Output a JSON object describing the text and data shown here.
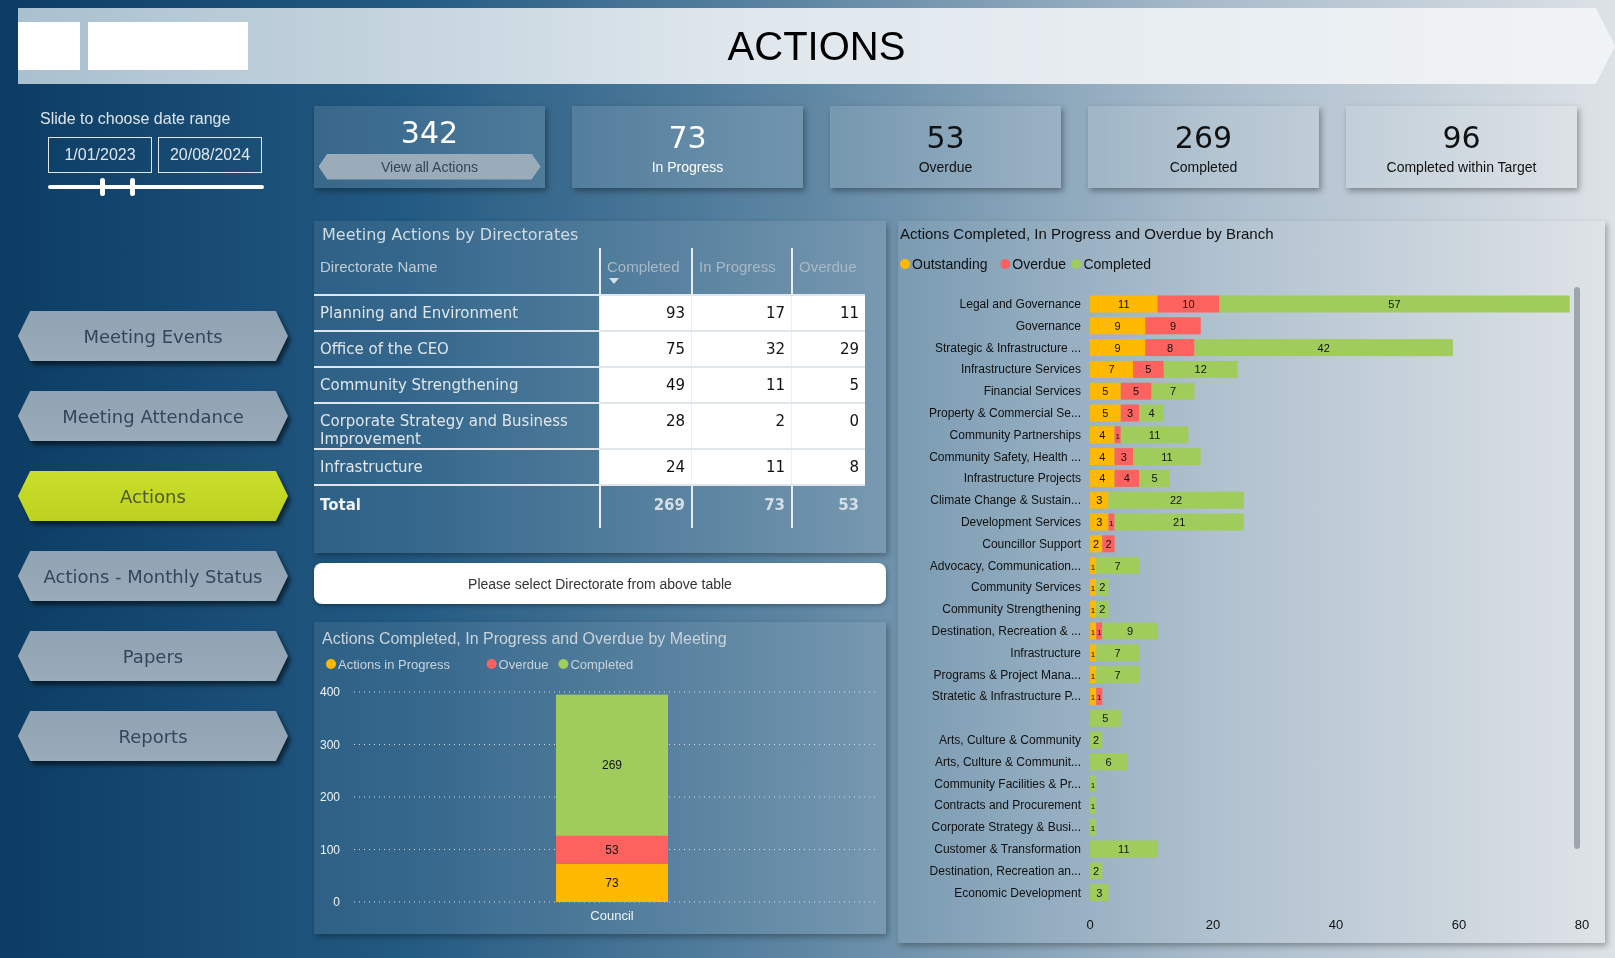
{
  "header": {
    "title": "ACTIONS"
  },
  "date_filter": {
    "label": "Slide to choose date range",
    "start": "1/01/2023",
    "end": "20/08/2024",
    "thumbs": [
      {
        "level": 0.25
      },
      {
        "level": 0.39
      }
    ]
  },
  "nav": [
    {
      "label": "Meeting Events",
      "selected": false
    },
    {
      "label": "Meeting Attendance",
      "selected": false
    },
    {
      "label": "Actions",
      "selected": true
    },
    {
      "label": "Actions - Monthly Status",
      "selected": false
    },
    {
      "label": "Papers",
      "selected": false
    },
    {
      "label": "Reports",
      "selected": false
    }
  ],
  "kpis": [
    {
      "value": "342",
      "button": "View all Actions"
    },
    {
      "value": "73",
      "label": "In Progress"
    },
    {
      "value": "53",
      "label": "Overdue"
    },
    {
      "value": "269",
      "label": "Completed"
    },
    {
      "value": "96",
      "label": "Completed within Target"
    }
  ],
  "directorate_table": {
    "title": "Meeting Actions by Directorates",
    "columns": [
      {
        "label": "Directorate Name",
        "sorted": false
      },
      {
        "label": "Completed",
        "sorted": true
      },
      {
        "label": "In Progress",
        "sorted": false
      },
      {
        "label": "Overdue",
        "sorted": false
      }
    ],
    "rows": [
      {
        "cells": [
          "Planning and Environment",
          "93",
          "17",
          "11"
        ]
      },
      {
        "cells": [
          "Office of the CEO",
          "75",
          "32",
          "29"
        ]
      },
      {
        "cells": [
          "Community Strengthening",
          "49",
          "11",
          "5"
        ]
      },
      {
        "cells": [
          "Corporate Strategy and Business Improvement",
          "28",
          "2",
          "0"
        ]
      },
      {
        "cells": [
          "Infrastructure",
          "24",
          "11",
          "8"
        ]
      }
    ],
    "total": [
      "Total",
      "269",
      "73",
      "53"
    ]
  },
  "message": "Please select Directorate from above table",
  "meeting_chart": {
    "chart_data": {
      "type": "bar",
      "title": "Actions Completed, In Progress and Overdue by Meeting",
      "categories": [
        "Council"
      ],
      "stacked": true,
      "orientation": "vertical",
      "data_labels": true,
      "grid": true,
      "legend": true,
      "ylim": [
        0,
        400
      ],
      "yticks": [
        0,
        100,
        200,
        300,
        400
      ],
      "series": [
        {
          "name": "Actions in Progress",
          "color": "#ffb900",
          "values": [
            73
          ]
        },
        {
          "name": "Overdue",
          "color": "#fd625e",
          "values": [
            53
          ]
        },
        {
          "name": "Completed",
          "color": "#a0cc5b",
          "values": [
            269
          ]
        }
      ]
    }
  },
  "branch_chart": {
    "chart_data": {
      "type": "bar",
      "title": "Actions Completed, In Progress and Overdue by Branch",
      "stacked": true,
      "orientation": "horizontal",
      "legend": true,
      "data_labels": true,
      "xlim": [
        0,
        80
      ],
      "xticks": [
        0,
        20,
        40,
        60,
        80
      ],
      "categories": [
        "Legal and Governance",
        "Governance",
        "Strategic & Infrastructure ...",
        "Infrastructure Services",
        "Financial Services",
        "Property & Commercial Se...",
        "Community Partnerships",
        "Community Safety, Health ...",
        "Infrastructure Projects",
        "Climate Change & Sustain...",
        "Development Services",
        "Councillor Support",
        "Advocacy, Communication...",
        "Community Services",
        "Community Strengthening",
        "Destination, Recreation & ...",
        "Infrastructure",
        "Programs & Project Mana...",
        "Stratetic & Infrastructure P...",
        null,
        "Arts, Culture & Community",
        "Arts, Culture & Communit...",
        "Community Facilities & Pr...",
        "Contracts and Procurement",
        "Corporate Strategy & Busi...",
        "Customer & Transformation",
        "Destination, Recreation an...",
        "Economic Development"
      ],
      "series": [
        {
          "name": "Outstanding",
          "color": "#ffb900",
          "values": [
            11,
            9,
            9,
            7,
            5,
            5,
            4,
            4,
            4,
            3,
            3,
            2,
            1,
            1,
            1,
            1,
            1,
            1,
            1,
            null,
            null,
            null,
            null,
            null,
            null,
            null,
            null,
            null
          ]
        },
        {
          "name": "Overdue",
          "color": "#fd625e",
          "values": [
            10,
            9,
            8,
            5,
            5,
            3,
            1,
            3,
            4,
            null,
            1,
            2,
            null,
            null,
            null,
            1,
            null,
            null,
            1,
            null,
            null,
            null,
            null,
            null,
            null,
            null,
            null,
            null
          ]
        },
        {
          "name": "Completed",
          "color": "#a0cc5b",
          "values": [
            57,
            null,
            42,
            12,
            7,
            4,
            11,
            11,
            5,
            22,
            21,
            null,
            7,
            2,
            2,
            9,
            7,
            7,
            null,
            5,
            2,
            6,
            1,
            1,
            1,
            11,
            2,
            3
          ]
        }
      ]
    }
  }
}
